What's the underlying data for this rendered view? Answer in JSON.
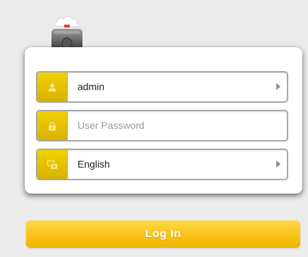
{
  "device": {
    "icon": "cloud-router-icon"
  },
  "login_form": {
    "username": {
      "value": "admin",
      "icon": "user-icon"
    },
    "password": {
      "placeholder": "User Password",
      "icon": "lock-icon"
    },
    "language": {
      "selected": "English",
      "icon": "language-icon"
    }
  },
  "login_button": {
    "label": "Log In"
  },
  "colors": {
    "accent": "#f5bf00",
    "icon_box": "#e3c000",
    "background": "#ebebeb"
  }
}
